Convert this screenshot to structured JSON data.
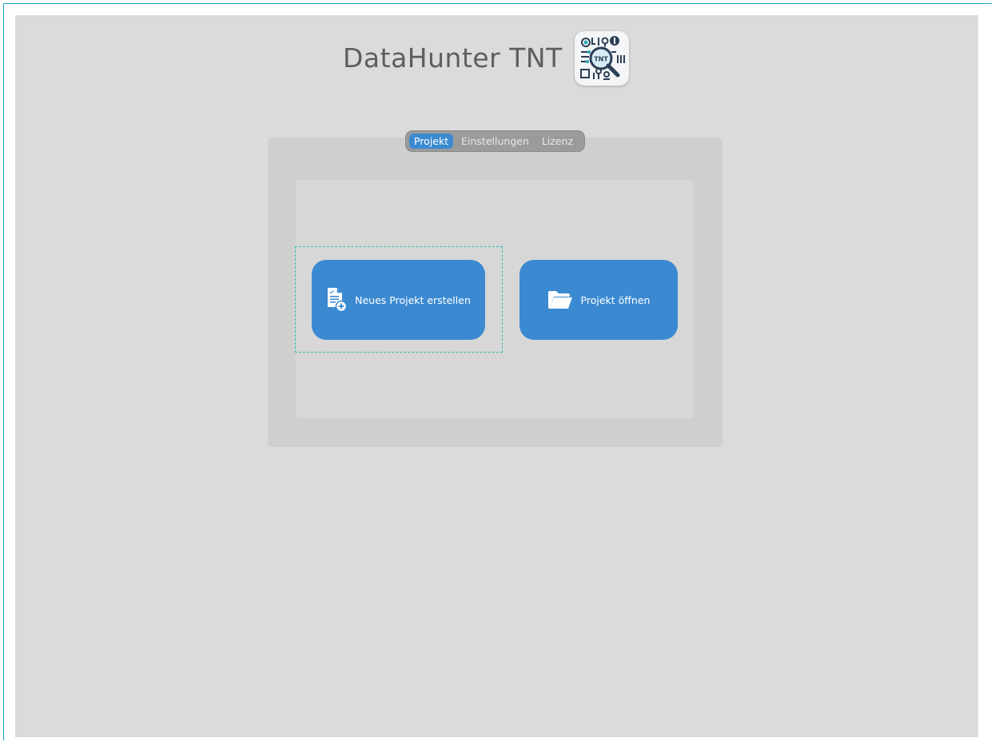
{
  "app": {
    "title": "DataHunter TNT",
    "logo_icon": "magnifier-circuit-logo-icon",
    "logo_badge_text": "TNT",
    "background_color": "#dbdbdb",
    "accent_color": "#3b8ad1"
  },
  "tabs": [
    {
      "label": "Projekt",
      "active": true
    },
    {
      "label": "Einstellungen",
      "active": false
    },
    {
      "label": "Lizenz",
      "active": false
    }
  ],
  "actions": {
    "new_project": {
      "label": "Neues Projekt erstellen",
      "icon": "new-document-icon",
      "focused": true
    },
    "open_project": {
      "label": "Projekt öffnen",
      "icon": "folder-open-icon",
      "focused": false
    }
  }
}
